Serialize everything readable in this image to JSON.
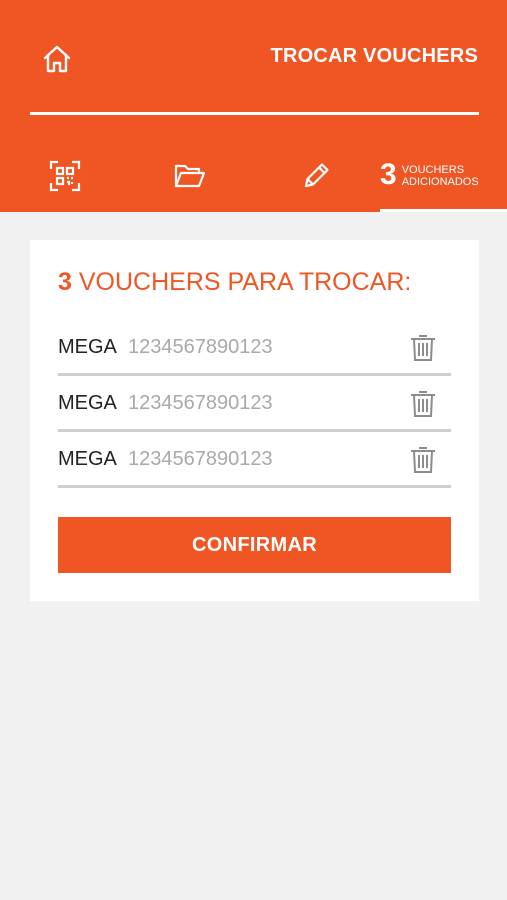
{
  "header": {
    "title": "TROCAR VOUCHERS",
    "home_icon": "home-icon"
  },
  "tabs": [
    {
      "icon": "qr-code-scan-icon"
    },
    {
      "icon": "folder-open-icon"
    },
    {
      "icon": "pencil-icon"
    },
    {
      "count": "3",
      "label_line1": "VOUCHERS",
      "label_line2": "ADICIONADOS",
      "active": true
    }
  ],
  "card": {
    "count": "3",
    "title": "VOUCHERS PARA TROCAR:",
    "vouchers": [
      {
        "brand": "MEGA",
        "code": "1234567890123",
        "delete_icon": "trash-icon"
      },
      {
        "brand": "MEGA",
        "code": "1234567890123",
        "delete_icon": "trash-icon"
      },
      {
        "brand": "MEGA",
        "code": "1234567890123",
        "delete_icon": "trash-icon"
      }
    ],
    "confirm_label": "CONFIRMAR"
  },
  "colors": {
    "accent": "#f05623",
    "background": "#f1f1f1",
    "card": "#ffffff",
    "code_text": "#a9a9a9",
    "divider": "#cfcfcf"
  }
}
